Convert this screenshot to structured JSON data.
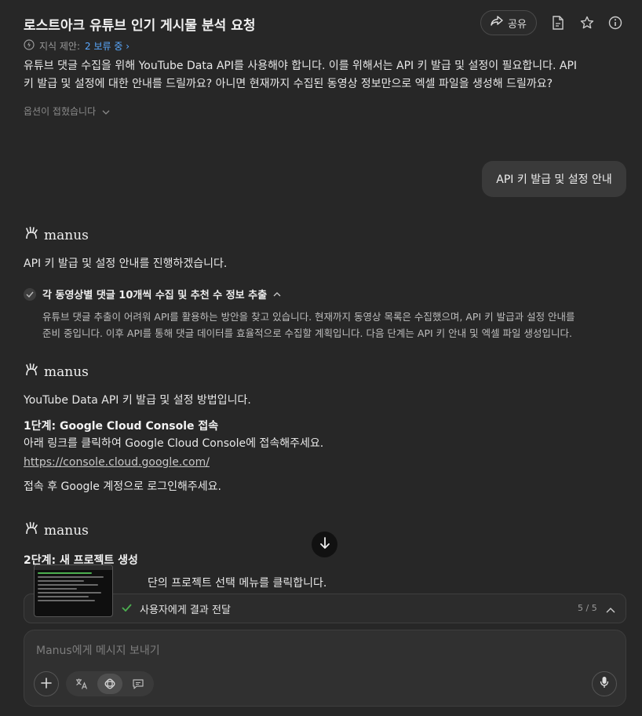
{
  "header": {
    "title": "로스트아크 유튜브 인기 게시물 분석 요청",
    "share_label": "공유"
  },
  "knowledge": {
    "label": "지식 제안:",
    "pending": "2 보류 중"
  },
  "intro_message": {
    "line1": "유튜브 댓글 수집을 위해 YouTube Data API를 사용해야 합니다. 이를 위해서는 API 키 발급 및 설정이 필요합니다. API",
    "line2": "키 발급 및 설정에 대한 안내를 드릴까요? 아니면 현재까지 수집된 동영상 정보만으로 엑셀 파일을 생성해 드릴까요?",
    "options_collapsed": "옵션이 접혔습니다"
  },
  "user_message": "API 키 발급 및 설정 안내",
  "brand": "manus",
  "reply1": {
    "text": "API 키 발급 및 설정 안내를 진행하겠습니다.",
    "task_title": "각 동영상별 댓글 10개씩 수집 및 추천 수 정보 추출",
    "task_desc_line1": "유튜브 댓글 추출이 어려워 API를 활용하는 방안을 찾고 있습니다. 현재까지 동영상 목록은 수집했으며, API 키 발급과 설정 안내를",
    "task_desc_line2": "준비 중입니다. 이후 API를 통해 댓글 데이터를 효율적으로 수집할 계획입니다. 다음 단계는 API 키 안내 및 엑셀 파일 생성입니다."
  },
  "reply2": {
    "intro": "YouTube Data API 키 발급 및 설정 방법입니다.",
    "step1_title": "1단계: Google Cloud Console 접속",
    "step1_text": "아래 링크를 클릭하여 Google Cloud Console에 접속해주세요.",
    "step1_link": "https://console.cloud.google.com/",
    "step1_after": "접속 후 Google 계정으로 로그인해주세요."
  },
  "reply3": {
    "step2_title": "2단계: 새 프로젝트 생성",
    "step2_text_visible": "단의 프로젝트 선택 메뉴를 클릭합니다."
  },
  "progress": {
    "label": "사용자에게 결과 전달",
    "count": "5 / 5",
    "status_color": "#4caf50"
  },
  "composer": {
    "placeholder": "Manus에게 메시지 보내기"
  },
  "colors": {
    "background": "#272727",
    "link_accent": "#5aa9ff"
  }
}
